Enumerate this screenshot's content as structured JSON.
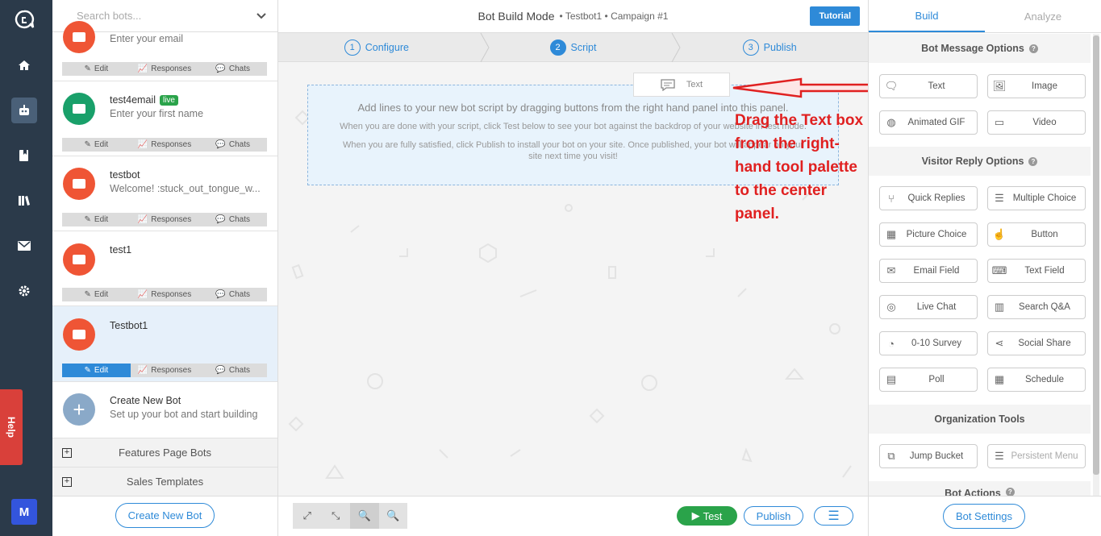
{
  "colors": {
    "accent": "#2e8ad8",
    "bot_red": "#ef5535",
    "bot_green": "#19a06a",
    "new_bot": "#8aa9c8",
    "live": "#2aa34a",
    "annotation": "#e02020"
  },
  "rail": {
    "icons": [
      "logo-icon",
      "home-icon",
      "robot-icon",
      "bookmark-icon",
      "library-icon",
      "mail-icon",
      "gear-icon"
    ],
    "help_label": "Help",
    "user_initial": "M"
  },
  "list": {
    "search_placeholder": "Search bots...",
    "bots": [
      {
        "name": "",
        "sub": "Enter your email",
        "live": "",
        "color": "#ef5535"
      },
      {
        "name": "test4email",
        "sub": "Enter your first name",
        "live": "live",
        "color": "#19a06a"
      },
      {
        "name": "testbot",
        "sub": "Welcome! :stuck_out_tongue_w...",
        "live": "",
        "color": "#ef5535"
      },
      {
        "name": "test1",
        "sub": "",
        "live": "",
        "color": "#ef5535"
      },
      {
        "name": "Testbot1",
        "sub": "",
        "live": "",
        "color": "#ef5535"
      }
    ],
    "actions": {
      "edit": "Edit",
      "responses": "Responses",
      "chats": "Chats"
    },
    "create": {
      "title": "Create New Bot",
      "sub": "Set up your bot and start building"
    },
    "groups": [
      "Features Page Bots",
      "Sales Templates"
    ],
    "create_button": "Create New Bot"
  },
  "header": {
    "mode": "Bot Build Mode",
    "bot": "Testbot1",
    "campaign": "Campaign #1",
    "tutorial": "Tutorial"
  },
  "steps": [
    {
      "num": "1",
      "label": "Configure"
    },
    {
      "num": "2",
      "label": "Script"
    },
    {
      "num": "3",
      "label": "Publish"
    }
  ],
  "canvas": {
    "line1": "Add lines to your new bot script by dragging buttons from the right hand panel into this panel.",
    "line2": "When you are done with your script, click Test below to see your bot against the backdrop of your website in test mode.",
    "line3": "When you are fully satisfied, click Publish to install your bot on your site. Once published, your bot will appear on your site next time you visit!",
    "ghost_label": "Text",
    "annotation": "Drag  the Text box from the right-hand tool palette to the center panel."
  },
  "bottom": {
    "test": "Test",
    "publish": "Publish"
  },
  "panel": {
    "tabs": [
      "Build",
      "Analyze"
    ],
    "sections": [
      "Bot Message Options",
      "Visitor Reply Options",
      "Organization Tools",
      "Bot Actions"
    ],
    "message_tools": [
      "Text",
      "Image",
      "Animated GIF",
      "Video"
    ],
    "reply_tools": [
      "Quick Replies",
      "Multiple Choice",
      "Picture Choice",
      "Button",
      "Email Field",
      "Text Field",
      "Live Chat",
      "Search Q&A",
      "0-10 Survey",
      "Social Share",
      "Poll",
      "Schedule"
    ],
    "org_tools": [
      "Jump Bucket",
      "Persistent Menu"
    ],
    "settings_button": "Bot Settings"
  }
}
